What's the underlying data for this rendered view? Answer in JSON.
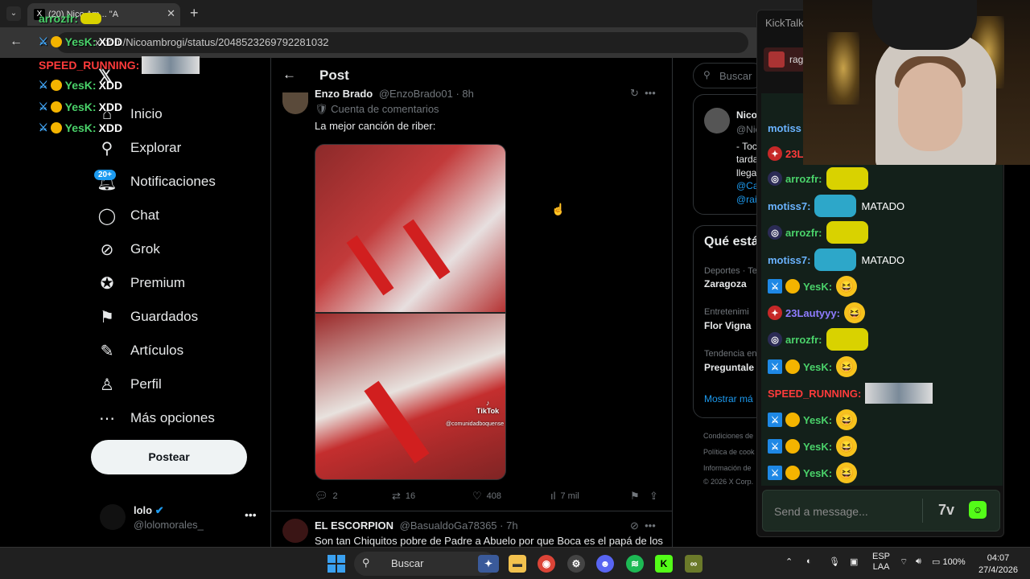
{
  "browser": {
    "tab_title": "(20) Nico Am... \"A",
    "tab_favicon": "X",
    "url": "x.com/Nicoambrogi/status/2048523269792281032"
  },
  "overlay_chat": [
    {
      "user": "arrozfr:",
      "text": ""
    },
    {
      "user": "YesK:",
      "text": "XDD"
    },
    {
      "user": "SPEED_RUNNING:",
      "text": ""
    },
    {
      "user": "YesK:",
      "text": "XDD"
    },
    {
      "user": "YesK:",
      "text": "XDD"
    },
    {
      "user": "YesK:",
      "text": "XDD"
    }
  ],
  "nav": {
    "items": [
      {
        "label": "Inicio",
        "icon": "home-icon"
      },
      {
        "label": "Explorar",
        "icon": "search-icon"
      },
      {
        "label": "Notificaciones",
        "icon": "bell-icon"
      },
      {
        "label": "Chat",
        "icon": "chat-icon"
      },
      {
        "label": "Grok",
        "icon": "grok-icon"
      },
      {
        "label": "Premium",
        "icon": "premium-icon"
      },
      {
        "label": "Guardados",
        "icon": "bookmark-icon"
      },
      {
        "label": "Artículos",
        "icon": "article-icon"
      },
      {
        "label": "Perfil",
        "icon": "person-icon"
      },
      {
        "label": "Más opciones",
        "icon": "more-icon"
      }
    ],
    "notifications_badge": "20+",
    "post_button": "Postear",
    "profile_name": "lolo",
    "profile_handle": "@lolomorales_"
  },
  "main": {
    "header_title": "Post",
    "tweet": {
      "author": "Enzo Brado",
      "handle": "@EnzoBrado01 · 8h",
      "community": "Cuenta de comentarios",
      "text": "La mejor canción de riber:",
      "video_watermark": "TikTok",
      "video_user": "@comunidadboquense",
      "replies": "2",
      "reposts": "16",
      "likes": "408",
      "views": "7 mil"
    },
    "tweet2": {
      "author": "EL ESCORPION",
      "handle": "@BasualdoGa78365 · 7h",
      "text": "Son tan Chiquitos pobre de Padre a Abuelo por que Boca es el papá de los"
    }
  },
  "right": {
    "search_placeholder": "Buscar",
    "author_name": "Nico",
    "author_handle": "@Nic",
    "post_lines": [
      "- Toc",
      "tarda",
      "llega",
      "@Ca",
      "@rai"
    ],
    "trends_title": "Qué está",
    "trends": [
      {
        "category": "Deportes · Te",
        "name": "Zaragoza"
      },
      {
        "category": "Entretenimi",
        "name": "Flor Vigna"
      },
      {
        "category": "Tendencia en",
        "name": "Preguntale"
      }
    ],
    "show_more": "Mostrar má",
    "footer": [
      "Condiciones de",
      "Política de cook",
      "Información de",
      "© 2026 X Corp."
    ]
  },
  "kicktalk": {
    "title": "KickTalk",
    "channel_tab": "rag",
    "partial_name": "rageylo",
    "input_placeholder": "Send a message...",
    "messages": [
      {
        "user": "motiss",
        "text": "",
        "color": "#6ab3ff",
        "kind": "partial"
      },
      {
        "user": "23L",
        "text": "",
        "color": "#ff3b3b",
        "kind": "partial"
      },
      {
        "user": "arrozfr:",
        "text": "",
        "color": "#4ad26a",
        "kind": "emote-wide"
      },
      {
        "user": "motiss7:",
        "text": "MATADO",
        "color": "#6ab3ff",
        "kind": "emote-blue"
      },
      {
        "user": "arrozfr:",
        "text": "",
        "color": "#4ad26a",
        "kind": "emote-wide"
      },
      {
        "user": "motiss7:",
        "text": "MATADO",
        "color": "#6ab3ff",
        "kind": "emote-blue"
      },
      {
        "user": "YesK:",
        "text": "",
        "color": "#4ad26a",
        "kind": "emoji"
      },
      {
        "user": "23Lautyyy:",
        "text": "",
        "color": "#8f7cff",
        "kind": "emoji"
      },
      {
        "user": "arrozfr:",
        "text": "",
        "color": "#4ad26a",
        "kind": "emote-wide"
      },
      {
        "user": "YesK:",
        "text": "",
        "color": "#4ad26a",
        "kind": "emoji"
      },
      {
        "user": "SPEED_RUNNING:",
        "text": "",
        "color": "#ff3b3b",
        "kind": "pic"
      },
      {
        "user": "YesK:",
        "text": "",
        "color": "#4ad26a",
        "kind": "emoji"
      },
      {
        "user": "YesK:",
        "text": "",
        "color": "#4ad26a",
        "kind": "emoji"
      },
      {
        "user": "YesK:",
        "text": "",
        "color": "#4ad26a",
        "kind": "emoji"
      }
    ]
  },
  "taskbar": {
    "search": "Buscar",
    "lang": "ESP",
    "lang2": "LAA",
    "battery": "100%",
    "time": "04:07",
    "date": "27/4/2026"
  },
  "colors": {
    "accent": "#1d9bf0",
    "kick_green": "#53fc18"
  }
}
